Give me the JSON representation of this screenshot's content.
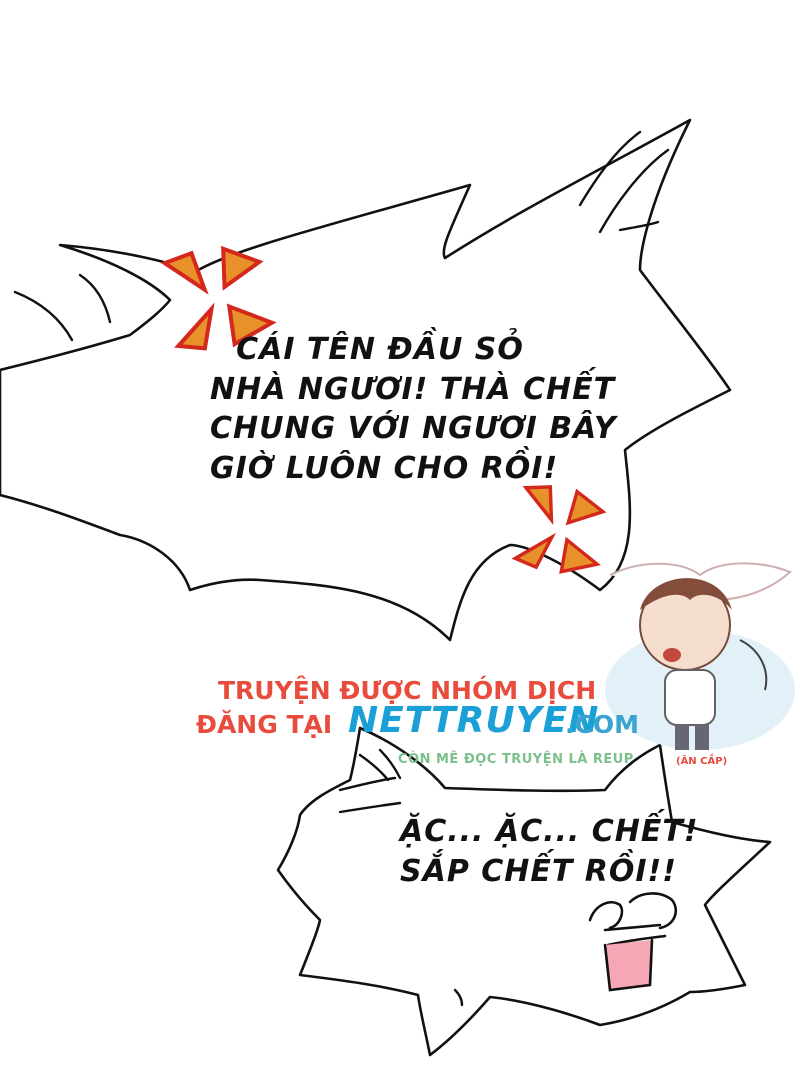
{
  "bubble_main": {
    "lines": [
      "CÁI TÊN ĐẦU SỎ",
      "NHÀ NGƯƠI! THÀ CHẾT",
      "CHUNG VỚI NGƯƠI BÂY",
      "GIỜ LUÔN CHO RỒI!"
    ]
  },
  "bubble_small": {
    "lines": [
      "ẶC... ẶC... CHẾT!",
      "SẮP CHẾT RỒI!!"
    ]
  },
  "watermark": {
    "line1": "TRUYỆN ĐƯỢC NHÓM DỊCH",
    "line2_prefix": "ĐĂNG TẠI",
    "brand": "NETTRUYEN",
    "domain": ".COM",
    "tagline": "CÒN MÊ ĐỌC TRUYỆN LÀ REUP",
    "tagline_note": "(ĂN CẮP)"
  },
  "colors": {
    "anger_mark": "#d4281c",
    "anger_mark_fill": "#e8902a",
    "watermark_red": "#e74c3c",
    "watermark_blue": "#1a9fd6",
    "watermark_green": "#7cc08a"
  },
  "icons": [
    "anger-mark-icon",
    "chibi-character",
    "scribble-face-icon"
  ]
}
